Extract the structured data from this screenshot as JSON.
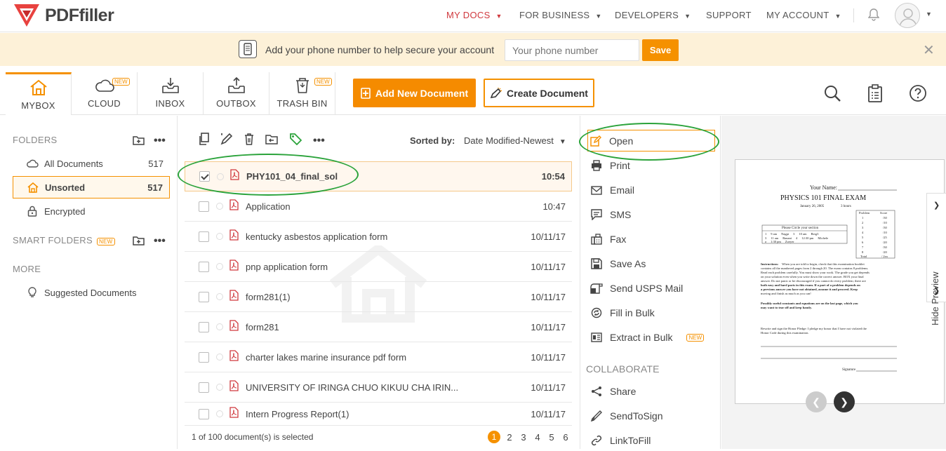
{
  "brand": {
    "name": "PDFfiller"
  },
  "nav": {
    "items": [
      {
        "label": "MY DOCS",
        "active": true
      },
      {
        "label": "FOR BUSINESS"
      },
      {
        "label": "DEVELOPERS"
      },
      {
        "label": "SUPPORT"
      },
      {
        "label": "MY ACCOUNT"
      }
    ]
  },
  "banner": {
    "text": "Add your phone number to help secure your account",
    "phone_placeholder": "Your phone number",
    "save_label": "Save"
  },
  "toolbar": {
    "tabs": [
      {
        "label": "MYBOX",
        "icon": "home-icon",
        "active": true
      },
      {
        "label": "CLOUD",
        "icon": "cloud-icon",
        "badge": "NEW"
      },
      {
        "label": "INBOX",
        "icon": "inbox-icon"
      },
      {
        "label": "OUTBOX",
        "icon": "outbox-icon"
      },
      {
        "label": "TRASH BIN",
        "icon": "trash-icon",
        "badge": "NEW"
      }
    ],
    "add_document": "Add New Document",
    "create_document": "Create Document"
  },
  "sidebar": {
    "folders_heading": "FOLDERS",
    "folders": [
      {
        "label": "All Documents",
        "count": "517"
      },
      {
        "label": "Unsorted",
        "count": "517",
        "active": true
      },
      {
        "label": "Encrypted",
        "count": ""
      }
    ],
    "smart_folders_heading": "SMART FOLDERS",
    "smart_badge": "NEW",
    "more_heading": "MORE",
    "more_items": [
      {
        "label": "Suggested Documents"
      }
    ]
  },
  "documents": {
    "sort_label": "Sorted by:",
    "sort_value": "Date Modified-Newest",
    "rows": [
      {
        "name": "PHY101_04_final_sol",
        "time": "10:54",
        "selected": true
      },
      {
        "name": "Application",
        "time": "10:47"
      },
      {
        "name": "kentucky asbestos application form",
        "time": "10/11/17"
      },
      {
        "name": "pnp application form",
        "time": "10/11/17"
      },
      {
        "name": "form281(1)",
        "time": "10/11/17"
      },
      {
        "name": "form281",
        "time": "10/11/17"
      },
      {
        "name": "charter lakes marine insurance pdf form",
        "time": "10/11/17"
      },
      {
        "name": "UNIVERSITY OF IRINGA CHUO KIKUU CHA IRIN...",
        "time": "10/11/17"
      },
      {
        "name": "Intern Progress Report(1)",
        "time": "10/11/17"
      }
    ],
    "footer": "1 of 100 document(s) is selected",
    "pages": [
      "1",
      "2",
      "3",
      "4",
      "5",
      "6"
    ],
    "current_page": "1"
  },
  "actions": {
    "items": [
      {
        "label": "Open",
        "icon": "edit-icon"
      },
      {
        "label": "Print",
        "icon": "print-icon"
      },
      {
        "label": "Email",
        "icon": "email-icon"
      },
      {
        "label": "SMS",
        "icon": "sms-icon"
      },
      {
        "label": "Fax",
        "icon": "fax-icon"
      },
      {
        "label": "Save As",
        "icon": "save-icon"
      },
      {
        "label": "Send USPS Mail",
        "icon": "mail-icon"
      },
      {
        "label": "Fill in Bulk",
        "icon": "bulk-icon"
      },
      {
        "label": "Extract in Bulk",
        "icon": "extract-icon",
        "badge": "NEW"
      }
    ],
    "collaborate_heading": "COLLABORATE",
    "collaborate": [
      {
        "label": "Share",
        "icon": "share-icon"
      },
      {
        "label": "SendToSign",
        "icon": "sign-icon"
      },
      {
        "label": "LinkToFill",
        "icon": "link-icon"
      }
    ]
  },
  "preview": {
    "hide_label": "Hide Preview",
    "doc": {
      "name_label": "Your Name:",
      "title": "PHYSICS 101 FINAL EXAM",
      "date": "January 26, 2005",
      "duration": "3 hours",
      "circle_label": "Please Circle your section",
      "sections": [
        [
          "1",
          "9 am",
          "Nagpi",
          "3",
          "10 am",
          "Berg3"
        ],
        [
          "3",
          "11 am",
          "Banani",
          "4",
          "12:30 pm",
          "Michele"
        ],
        [
          "a",
          "1:30 pm",
          "Zoeyer",
          "",
          "",
          ""
        ]
      ],
      "scores": [
        [
          "Problem",
          "Score"
        ],
        [
          "1",
          "/30"
        ],
        [
          "2",
          "/10"
        ],
        [
          "3",
          "/30"
        ],
        [
          "4",
          "/10"
        ],
        [
          "5",
          "/25"
        ],
        [
          "6",
          "/20"
        ],
        [
          "7",
          "/30"
        ],
        [
          "8",
          "/20"
        ],
        [
          "Total",
          "/ 2xx"
        ]
      ],
      "instructions_head": "Instructions:",
      "instructions_1": "When you are told to begin, check that this examination booklet",
      "instructions_2": "contains all the numbered pages from 2 through 20. The exam contains 8 problems.",
      "instructions_3": "Read each problem carefully. You must show your work. The grade you get depends",
      "instructions_4": "on your solution even when you write down the correct answer. BOX your final",
      "instructions_5": "answer. Do not panic or be discouraged if you cannot do every problem; there are",
      "instructions_6": "both easy and hard parts in this exam. If a part of a problem depends on",
      "instructions_7": "a previous answer you have not obtained, assume it and proceed. Keep",
      "instructions_8": "moving and finish as much as you can!",
      "constants_1": "Possibly useful constants and equations are on the last page, which you",
      "constants_2": "may want to tear off and keep handy.",
      "honor_1": "Rewrite and sign the Honor Pledge: I pledge my honor that I have not violated the",
      "honor_2": "Honor Code during this examination.",
      "signature_label": "Signature"
    }
  }
}
